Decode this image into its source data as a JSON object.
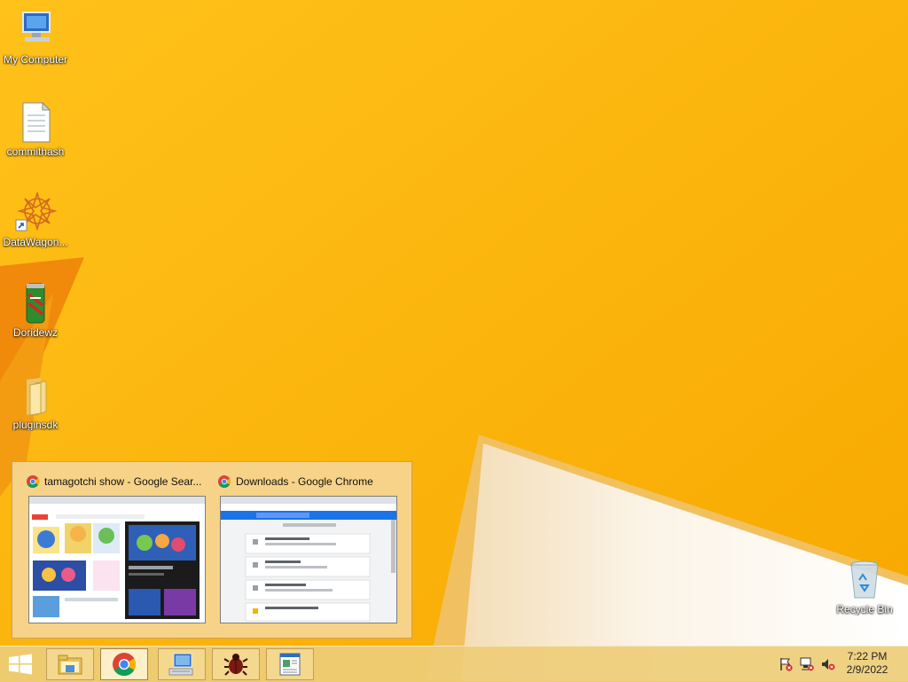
{
  "desktop": {
    "icons": [
      {
        "label": "My Computer"
      },
      {
        "label": "commithash"
      },
      {
        "label": "DataWagon..."
      },
      {
        "label": "Doridewz"
      },
      {
        "label": "pluginsdk"
      },
      {
        "label": "Recycle Bin"
      }
    ]
  },
  "thumbnail_popup": {
    "windows": [
      {
        "title": "tamagotchi show - Google Sear...",
        "icon": "chrome-icon"
      },
      {
        "title": "Downloads - Google Chrome",
        "icon": "chrome-icon"
      }
    ]
  },
  "taskbar": {
    "pinned": [
      {
        "name": "file-explorer-icon"
      },
      {
        "name": "chrome-icon",
        "active": true
      },
      {
        "name": "remote-desktop-icon"
      },
      {
        "name": "bug-app-icon"
      },
      {
        "name": "document-app-icon"
      }
    ],
    "tray_icons": [
      "action-center-flag-icon",
      "network-icon",
      "volume-muted-icon"
    ],
    "clock": {
      "time": "7:22 PM",
      "date": "2/9/2022"
    }
  },
  "colors": {
    "wallpaper": "#f7b400",
    "accent": "#f08a00"
  }
}
